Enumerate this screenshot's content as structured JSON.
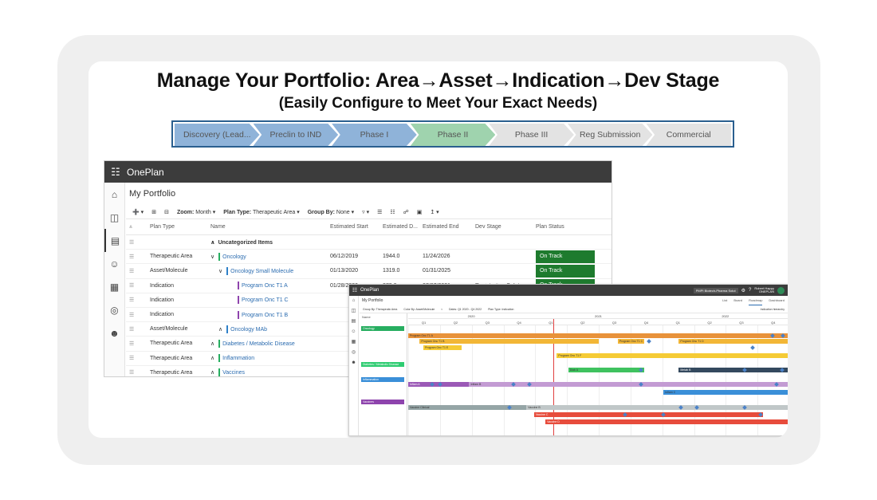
{
  "heading": {
    "title": "Manage Your Portfolio: Area→Asset→Indication→Dev Stage",
    "subtitle": "(Easily Configure to Meet Your Exact Needs)"
  },
  "stages": [
    {
      "label": "Discovery (Lead...",
      "color": "#8fb3d9"
    },
    {
      "label": "Preclin to IND",
      "color": "#8fb3d9"
    },
    {
      "label": "Phase I",
      "color": "#8fb3d9"
    },
    {
      "label": "Phase II",
      "color": "#9fd3ae"
    },
    {
      "label": "Phase III",
      "color": "#e3e3e3"
    },
    {
      "label": "Reg Submission",
      "color": "#e3e3e3"
    },
    {
      "label": "Commercial",
      "color": "#e3e3e3"
    }
  ],
  "app1": {
    "brand": "OnePlan",
    "page_title": "My Portfolio",
    "toolbar": {
      "zoom_label": "Zoom:",
      "zoom_value": "Month",
      "plan_type_label": "Plan Type:",
      "plan_type_value": "Therapeutic Area",
      "group_by_label": "Group By:",
      "group_by_value": "None"
    },
    "columns": [
      "Plan Type",
      "Name",
      "Estimated Start",
      "Estimated D...",
      "Estimated End",
      "Dev Stage",
      "Plan Status"
    ],
    "group_row": "Uncategorized Items",
    "rows": [
      {
        "type": "Therapeutic Area",
        "chev": "∨",
        "name": "Oncology",
        "color": "#27ae60",
        "indent": 0,
        "start": "06/12/2019",
        "dur": "1944.0",
        "end": "11/24/2026",
        "stage": "",
        "status": "On Track"
      },
      {
        "type": "Asset/Molecule",
        "chev": "∨",
        "name": "Oncology Small Molecule",
        "color": "#2f80c8",
        "indent": 10,
        "start": "01/13/2020",
        "dur": "1319.0",
        "end": "01/31/2025",
        "stage": "",
        "status": "On Track"
      },
      {
        "type": "Indication",
        "chev": "",
        "name": "Program Onc T1 A",
        "color": "#8e44ad",
        "indent": 34,
        "start": "01/28/2020",
        "dur": "373.0",
        "end": "07/07/2021",
        "stage": "Registration Safety",
        "status": "On Track"
      },
      {
        "type": "Indication",
        "chev": "",
        "name": "Program Onc T1 C",
        "color": "#8e44ad",
        "indent": 34,
        "start": "",
        "dur": "",
        "end": "",
        "stage": "",
        "status": ""
      },
      {
        "type": "Indication",
        "chev": "",
        "name": "Program Onc T1 B",
        "color": "#8e44ad",
        "indent": 34,
        "start": "",
        "dur": "",
        "end": "",
        "stage": "",
        "status": ""
      },
      {
        "type": "Asset/Molecule",
        "chev": "∧",
        "name": "Oncology MAb",
        "color": "#2f80c8",
        "indent": 10,
        "start": "",
        "dur": "",
        "end": "",
        "stage": "",
        "status": ""
      },
      {
        "type": "Therapeutic Area",
        "chev": "∧",
        "name": "Diabetes / Metabolic Disease",
        "color": "#27ae60",
        "indent": 0,
        "start": "",
        "dur": "",
        "end": "",
        "stage": "",
        "status": ""
      },
      {
        "type": "Therapeutic Area",
        "chev": "∧",
        "name": "Inflammation",
        "color": "#27ae60",
        "indent": 0,
        "start": "",
        "dur": "",
        "end": "",
        "stage": "",
        "status": ""
      },
      {
        "type": "Therapeutic Area",
        "chev": "∧",
        "name": "Vaccines",
        "color": "#27ae60",
        "indent": 0,
        "start": "",
        "dur": "",
        "end": "",
        "stage": "",
        "status": ""
      }
    ]
  },
  "app2": {
    "brand": "OnePlan",
    "tenant": "PMPI Biotech-Pharma Solut",
    "user": "Robert Happy",
    "user_org": "ONEPLAN",
    "page_title": "My Portfolio",
    "views": [
      "List",
      "Board",
      "Roadmap",
      "Dashboard"
    ],
    "toolbar": {
      "group_by": "Group By: Therapeutic Area",
      "color_by": "Color By: Asset/Molecule",
      "dates": "Dates: Q1 2020 - Q4 2022",
      "plan_type": "Plan Type: Indication",
      "right": "Indication hierarchy"
    },
    "name_header": "Name",
    "years": [
      "2020",
      "2021",
      "2022"
    ],
    "quarters": [
      "Q1",
      "Q2",
      "Q3",
      "Q4",
      "Q1",
      "Q2",
      "Q3",
      "Q4",
      "Q1",
      "Q2",
      "Q3",
      "Q4"
    ],
    "groups": [
      {
        "label": "Oncology",
        "color": "#27ae60"
      },
      {
        "label": "Diabetes / Metabolic Disease",
        "color": "#2ecc71"
      },
      {
        "label": "Inflammation",
        "color": "#3a8fd8"
      },
      {
        "label": "Vaccines",
        "color": "#8e44ad"
      }
    ],
    "bars": [
      {
        "label": "Program Onc T1 A",
        "color": "#e8923a",
        "x0": 0.0,
        "x1": 1.0
      },
      {
        "label": "Program Onc T1 B",
        "color": "#f2b636",
        "x0": 0.03,
        "x1": 0.5
      },
      {
        "label": "Program Onc T1 C",
        "color": "#f2b636",
        "x0": 0.55,
        "x1": 0.62
      },
      {
        "label": "Program Onc T1 D",
        "color": "#f2b636",
        "x0": 0.71,
        "x1": 1.0
      },
      {
        "label": "Program Onc T1 E",
        "color": "#f5cb35",
        "x0": 0.04,
        "x1": 0.14
      },
      {
        "label": "Program Onc T1 F",
        "color": "#f5cb35",
        "x0": 0.39,
        "x1": 1.0
      },
      {
        "label": "Diab A",
        "color": "#3fc25f",
        "x0": 0.42,
        "x1": 0.62
      },
      {
        "label": "Metab B",
        "color": "#34495e",
        "x0": 0.71,
        "x1": 1.0
      },
      {
        "label": "Inflam A",
        "color": "#9b59b6",
        "x0": 0.0,
        "x1": 0.16
      },
      {
        "label": "Inflam B",
        "color": "#c39bd3",
        "x0": 0.16,
        "x1": 1.0
      },
      {
        "label": "Inflam C",
        "color": "#3a8fd8",
        "x0": 0.67,
        "x1": 1.0
      },
      {
        "label": "Vaccine Clinical",
        "color": "#95a5a6",
        "x0": 0.0,
        "x1": 0.31
      },
      {
        "label": "Vaccine B",
        "color": "#c0c7c8",
        "x0": 0.31,
        "x1": 1.0
      },
      {
        "label": "Vaccine C",
        "color": "#e74c3c",
        "x0": 0.33,
        "x1": 0.93
      },
      {
        "label": "Vaccine D",
        "color": "#e74c3c",
        "x0": 0.36,
        "x1": 1.0
      }
    ]
  }
}
